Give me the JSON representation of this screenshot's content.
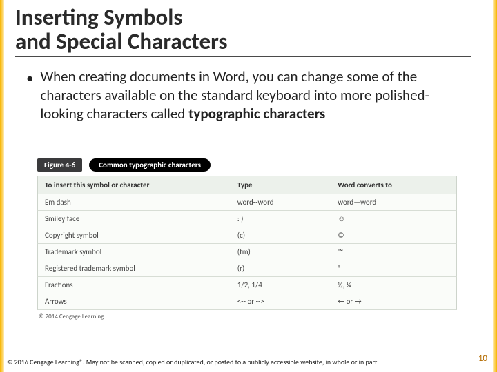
{
  "title_line1": "Inserting Symbols",
  "title_line2": "and Special Characters",
  "bullet": {
    "text_before": "When creating documents in Word, you can change some of the characters available on the standard keyboard into more polished-looking characters called ",
    "bold": "typographic characters"
  },
  "figure": {
    "label": "Figure 4-6",
    "title": "Common typographic characters",
    "headers": [
      "To insert this symbol or character",
      "Type",
      "Word converts to"
    ],
    "rows": [
      [
        "Em dash",
        "word--word",
        "word—word"
      ],
      [
        "Smiley face",
        ": )",
        "☺"
      ],
      [
        "Copyright symbol",
        "(c)",
        "©"
      ],
      [
        "Trademark symbol",
        "(tm)",
        "™"
      ],
      [
        "Registered trademark symbol",
        "(r)",
        "®"
      ],
      [
        "Fractions",
        "1/2, 1/4",
        "½, ¼"
      ],
      [
        "Arrows",
        "<-- or -->",
        "← or →"
      ]
    ],
    "attribution": "© 2014 Cengage Learning"
  },
  "footer": "© 2016 Cengage Learning®. May not be scanned, copied or duplicated, or posted to a publicly accessible website, in whole or in part.",
  "page": "10"
}
